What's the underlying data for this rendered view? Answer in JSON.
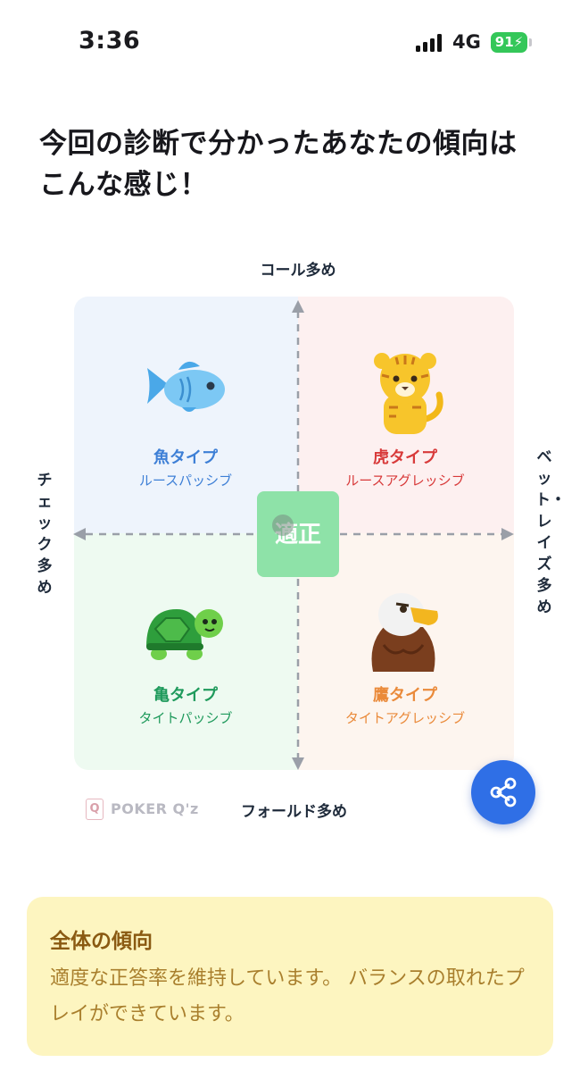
{
  "status_bar": {
    "time": "3:36",
    "network": "4G",
    "battery": "91"
  },
  "heading": {
    "title_line1": "今回の診断で分かったあなたの傾向は",
    "title_line2": "こんな感じ！"
  },
  "chart": {
    "axis_top": "コール多め",
    "axis_bottom": "フォールド多め",
    "axis_left": "チェック多め",
    "axis_right": "ベット・レイズ多め",
    "center_label": "適正",
    "quadrants": {
      "fish": {
        "name": "魚タイプ",
        "sub": "ルースパッシブ",
        "color": "#3d7fd6",
        "icon": "fish-icon"
      },
      "tiger": {
        "name": "虎タイプ",
        "sub": "ルースアグレッシブ",
        "color": "#d83a3a",
        "icon": "tiger-icon"
      },
      "turtle": {
        "name": "亀タイプ",
        "sub": "タイトパッシブ",
        "color": "#1f9a5c",
        "icon": "turtle-icon"
      },
      "eagle": {
        "name": "鷹タイプ",
        "sub": "タイトアグレッシブ",
        "color": "#ea8a3a",
        "icon": "eagle-icon"
      }
    },
    "logo_text": "POKER Q'z",
    "logo_mark": "Q"
  },
  "share": {
    "icon": "share-icon"
  },
  "summary": {
    "title": "全体の傾向",
    "text": "適度な正答率を維持しています。 バランスの取れたプレイができています。"
  }
}
